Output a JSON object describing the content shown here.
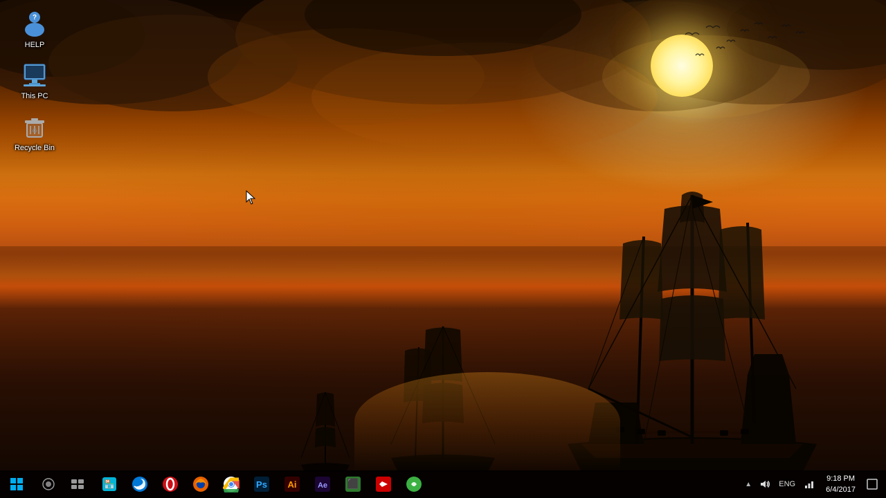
{
  "desktop": {
    "icons": [
      {
        "id": "help",
        "label": "HELP",
        "icon_type": "help"
      },
      {
        "id": "this-pc",
        "label": "This PC",
        "icon_type": "this-pc"
      },
      {
        "id": "recycle-bin",
        "label": "Recycle Bin",
        "icon_type": "recycle-bin"
      }
    ]
  },
  "taskbar": {
    "start_label": "Start",
    "cortana_label": "Cortana",
    "taskview_label": "Task View",
    "apps": [
      {
        "id": "store",
        "label": "Microsoft Store",
        "color": "#00b4d8"
      },
      {
        "id": "edge",
        "label": "Microsoft Edge",
        "color": "#0078d7"
      },
      {
        "id": "opera",
        "label": "Opera",
        "color": "#cc0f16"
      },
      {
        "id": "firefox",
        "label": "Firefox",
        "color": "#e76000"
      },
      {
        "id": "chrome",
        "label": "Chrome",
        "color": "#4caf50"
      },
      {
        "id": "photoshop",
        "label": "Photoshop",
        "color": "#001e36"
      },
      {
        "id": "illustrator",
        "label": "Illustrator",
        "color": "#300"
      },
      {
        "id": "after-effects",
        "label": "After Effects",
        "color": "#1a0533"
      },
      {
        "id": "unknown-green",
        "label": "App",
        "color": "#3c763d"
      },
      {
        "id": "unknown-red",
        "label": "App",
        "color": "#c00"
      },
      {
        "id": "unknown-green2",
        "label": "App",
        "color": "#2d7a2d"
      }
    ],
    "tray": {
      "chevron": "^",
      "lang": "ENG",
      "time": "9:18 PM",
      "date": "6/4/2017",
      "notification_icon": "☐"
    }
  }
}
